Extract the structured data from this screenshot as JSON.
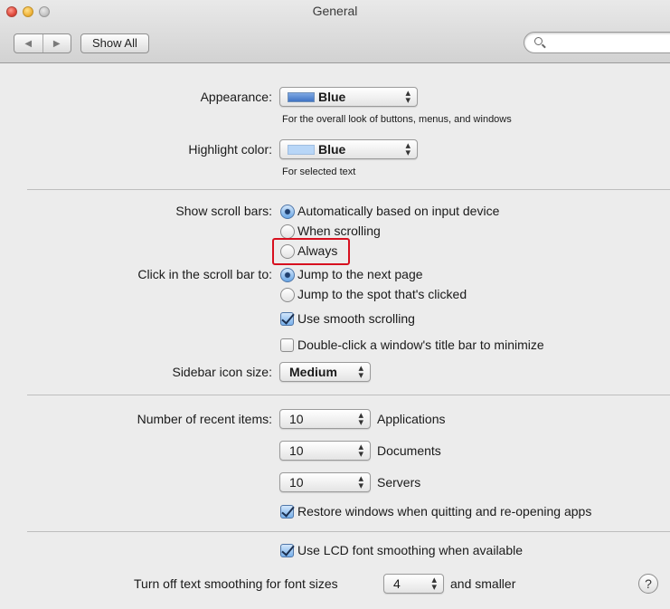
{
  "window": {
    "title": "General"
  },
  "toolbar": {
    "back": "◀",
    "forward": "▶",
    "show_all": "Show All",
    "search_placeholder": ""
  },
  "appearance": {
    "label": "Appearance:",
    "value": "Blue",
    "swatch_color": "#4f84cf",
    "help": "For the overall look of buttons, menus, and windows"
  },
  "highlight": {
    "label": "Highlight color:",
    "value": "Blue",
    "swatch_color": "#b8d6f7",
    "help": "For selected text"
  },
  "scroll_bars": {
    "label": "Show scroll bars:",
    "options": [
      {
        "label": "Automatically based on input device",
        "selected": true
      },
      {
        "label": "When scrolling",
        "selected": false
      },
      {
        "label": "Always",
        "selected": false
      }
    ]
  },
  "click_scroll": {
    "label": "Click in the scroll bar to:",
    "options": [
      {
        "label": "Jump to the next page",
        "selected": true
      },
      {
        "label": "Jump to the spot that's clicked",
        "selected": false
      }
    ]
  },
  "checkboxes": {
    "smooth_scrolling": {
      "label": "Use smooth scrolling",
      "checked": true
    },
    "double_click_minimize": {
      "label": "Double-click a window's title bar to minimize",
      "checked": false
    },
    "restore_windows": {
      "label": "Restore windows when quitting and re-opening apps",
      "checked": true
    },
    "lcd_smoothing": {
      "label": "Use LCD font smoothing when available",
      "checked": true
    }
  },
  "sidebar_icon": {
    "label": "Sidebar icon size:",
    "value": "Medium"
  },
  "recent_items": {
    "label": "Number of recent items:",
    "rows": [
      {
        "value": "10",
        "suffix": "Applications"
      },
      {
        "value": "10",
        "suffix": "Documents"
      },
      {
        "value": "10",
        "suffix": "Servers"
      }
    ]
  },
  "text_smoothing": {
    "label": "Turn off text smoothing for font sizes",
    "value": "4",
    "suffix": "and smaller"
  },
  "help_button": "?",
  "highlight_box_color": "#d7101f"
}
